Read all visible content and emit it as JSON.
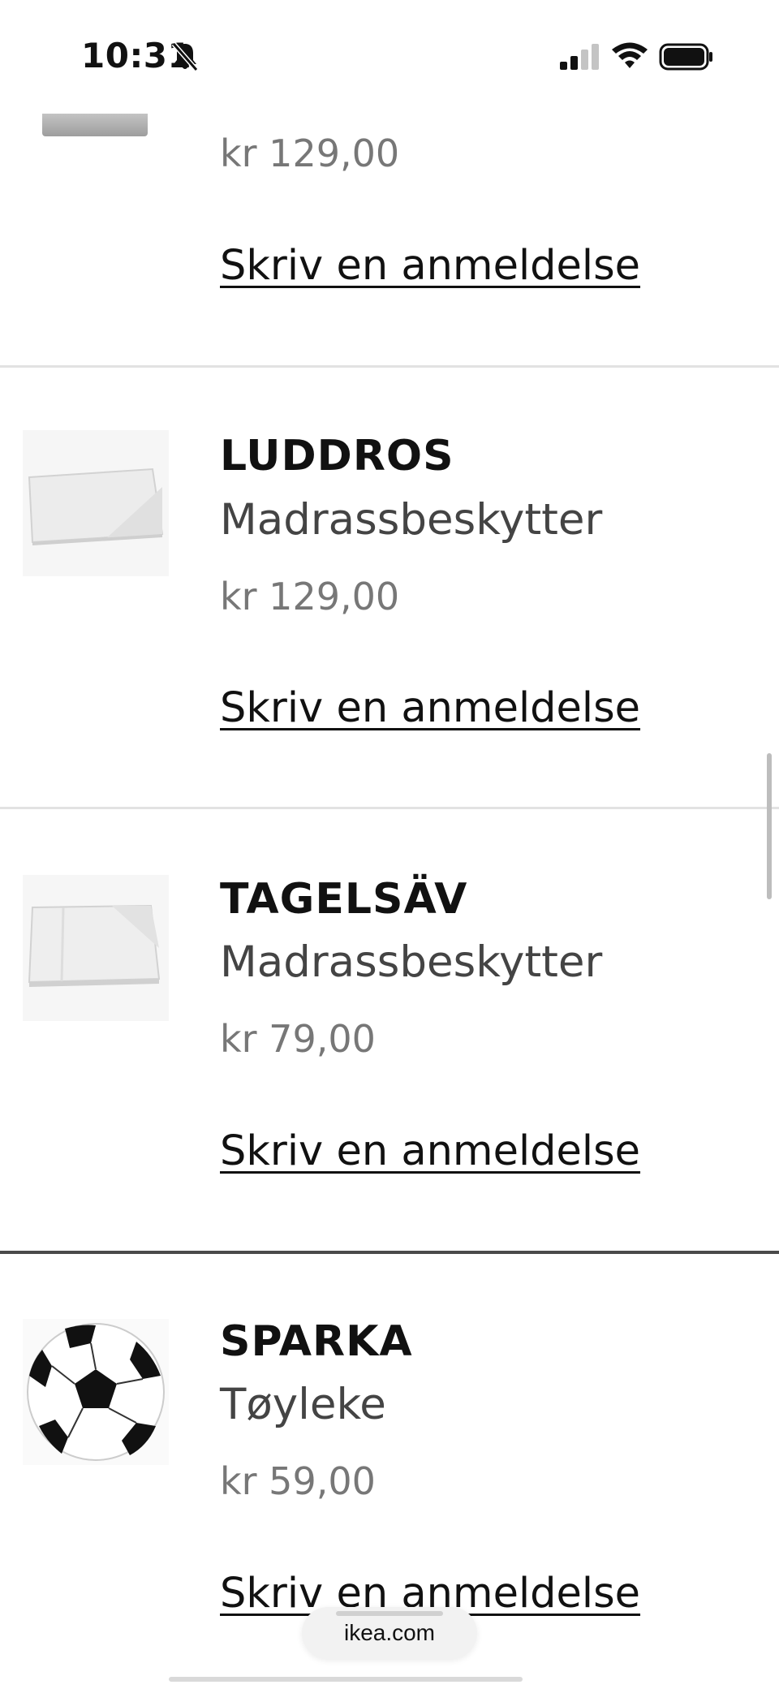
{
  "status_bar": {
    "time": "10:31",
    "icons": [
      "bell-slash-icon",
      "signal-icon",
      "wifi-icon",
      "battery-icon"
    ]
  },
  "partial_item": {
    "price": "kr 129,00",
    "review_link": "Skriv en anmeldelse"
  },
  "items": [
    {
      "name": "LUDDROS",
      "description": "Madrassbeskytter",
      "price": "kr 129,00",
      "review_link": "Skriv en anmeldelse",
      "image": "folded-mattress-protector"
    },
    {
      "name": "TAGELSÄV",
      "description": "Madrassbeskytter",
      "price": "kr 79,00",
      "review_link": "Skriv en anmeldelse",
      "image": "folded-mattress-protector"
    },
    {
      "name": "SPARKA",
      "description": "Tøyleke",
      "price": "kr 59,00",
      "review_link": "Skriv en anmeldelse",
      "image": "soccer-ball"
    }
  ],
  "browser": {
    "url": "ikea.com"
  }
}
